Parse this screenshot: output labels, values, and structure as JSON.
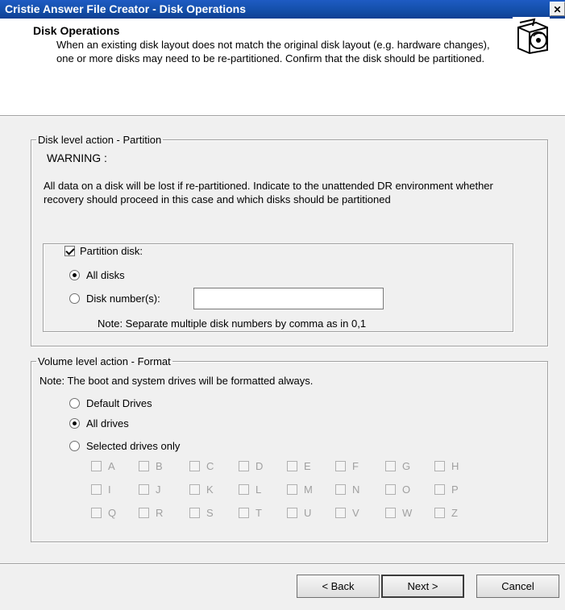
{
  "window": {
    "title": "Cristie Answer File Creator - Disk Operations",
    "close": "✕"
  },
  "header": {
    "title": "Disk Operations",
    "description": "When an existing disk layout does not match the original disk layout (e.g. hardware changes), one or more disks may need to be re-partitioned. Confirm that the disk should be partitioned.",
    "icon": "disk-box-icon"
  },
  "disk_group": {
    "legend": "Disk level action - Partition",
    "warning_title": "WARNING :",
    "warning_text": "All data on a disk will be lost if re-partitioned. Indicate to the unattended DR environment whether recovery should proceed in this case and which disks should be partitioned",
    "partition_checkbox": {
      "label": "Partition disk:",
      "checked": true
    },
    "options": [
      {
        "label": "All disks",
        "selected": true
      },
      {
        "label": "Disk number(s):",
        "selected": false
      }
    ],
    "disk_numbers_value": "",
    "note": "Note:  Separate multiple disk numbers by comma as in 0,1"
  },
  "volume_group": {
    "legend": "Volume level action - Format",
    "note": "Note: The boot and system drives will be formatted always.",
    "options": [
      {
        "label": "Default Drives",
        "selected": false
      },
      {
        "label": "All drives",
        "selected": true
      },
      {
        "label": "Selected drives only",
        "selected": false
      }
    ],
    "drives": [
      [
        "A",
        "B",
        "C",
        "D",
        "E",
        "F",
        "G",
        "H"
      ],
      [
        "I",
        "J",
        "K",
        "L",
        "M",
        "N",
        "O",
        "P"
      ],
      [
        "Q",
        "R",
        "S",
        "T",
        "U",
        "V",
        "W",
        "Z"
      ]
    ]
  },
  "buttons": {
    "back": "< Back",
    "next": "Next >",
    "cancel": "Cancel"
  }
}
